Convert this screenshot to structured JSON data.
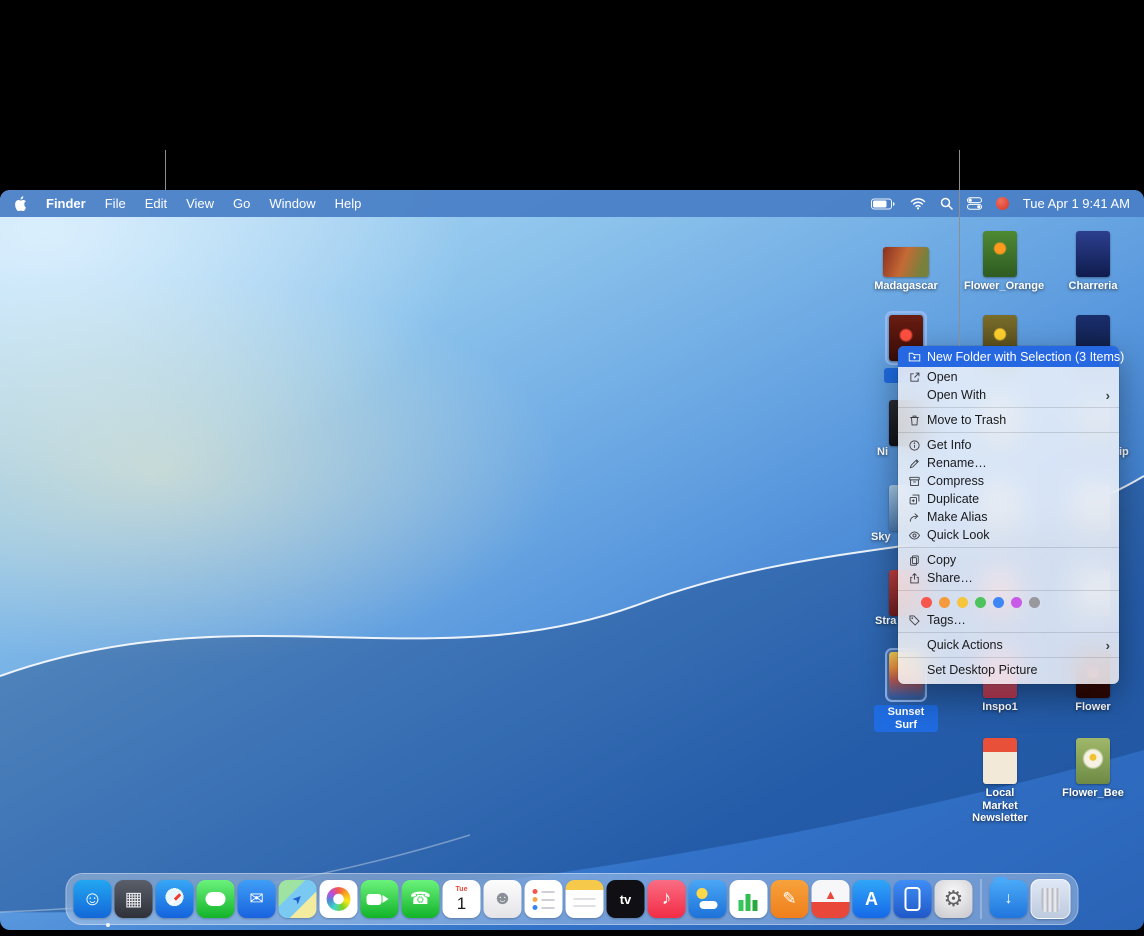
{
  "menu_bar": {
    "app_name": "Finder",
    "menus": [
      "File",
      "Edit",
      "View",
      "Go",
      "Window",
      "Help"
    ],
    "clock": "Tue Apr 1 9:41 AM",
    "status_icons": [
      "battery-icon",
      "wifi-icon",
      "spotlight-icon",
      "control-center-icon",
      "red-status-icon"
    ]
  },
  "desktop": {
    "icons": [
      {
        "label": "Madagascar",
        "selected": false
      },
      {
        "label": "Flower_Orange",
        "selected": false
      },
      {
        "label": "Charreria",
        "selected": false
      },
      {
        "label": "",
        "selected": true
      },
      {
        "label": "",
        "selected": false
      },
      {
        "label": "",
        "selected": false
      },
      {
        "label": "",
        "selected": false
      },
      {
        "label": "",
        "selected": false
      },
      {
        "label": "",
        "selected": false
      },
      {
        "label": "",
        "selected": false
      },
      {
        "label": "",
        "selected": false
      },
      {
        "label": "",
        "selected": false
      },
      {
        "label": "",
        "selected": false
      },
      {
        "label": "",
        "selected": false
      },
      {
        "label": "",
        "selected": false
      },
      {
        "label": "Sunset Surf",
        "selected": true
      },
      {
        "label": "Inspo1",
        "selected": false
      },
      {
        "label": "Flower",
        "selected": false
      },
      {
        "label": "Local Market Newsletter",
        "selected": false
      },
      {
        "label": "Flower_Bee",
        "selected": false
      }
    ],
    "label_fragments": [
      "Ni",
      "ip",
      "Sky",
      "Stra"
    ]
  },
  "context_menu": {
    "items": [
      {
        "label": "New Folder with Selection (3 Items)",
        "icon": "new-folder-icon",
        "highlighted": true
      },
      {
        "label": "Open",
        "icon": "open-icon"
      },
      {
        "label": "Open With",
        "submenu": true
      },
      {
        "label": "Move to Trash",
        "icon": "trash-icon"
      },
      {
        "label": "Get Info",
        "icon": "info-icon"
      },
      {
        "label": "Rename…",
        "icon": "rename-icon"
      },
      {
        "label": "Compress",
        "icon": "compress-icon"
      },
      {
        "label": "Duplicate",
        "icon": "duplicate-icon"
      },
      {
        "label": "Make Alias",
        "icon": "alias-icon"
      },
      {
        "label": "Quick Look",
        "icon": "quick-look-icon"
      },
      {
        "label": "Copy",
        "icon": "copy-icon"
      },
      {
        "label": "Share…",
        "icon": "share-icon"
      },
      {
        "label": "Tags…",
        "icon": "tag-icon"
      },
      {
        "label": "Quick Actions",
        "submenu": true
      },
      {
        "label": "Set Desktop Picture"
      }
    ],
    "tag_colors": [
      "#f6564c",
      "#f59b3c",
      "#f5c53d",
      "#4fc35b",
      "#3f87f5",
      "#c95ae8",
      "#98989d"
    ]
  },
  "dock": {
    "calendar_weekday": "Tue",
    "calendar_day": "1",
    "tv_label": "tv",
    "app_store_letter": "A",
    "apps": [
      "finder",
      "launchpad",
      "safari",
      "messages",
      "mail",
      "maps",
      "photos",
      "facetime",
      "phone",
      "calendar",
      "contacts",
      "reminders",
      "notes",
      "apple-tv",
      "music",
      "weather",
      "numbers",
      "pages",
      "rocket",
      "app-store",
      "iphone-mirroring",
      "settings",
      "downloads",
      "trash"
    ]
  }
}
